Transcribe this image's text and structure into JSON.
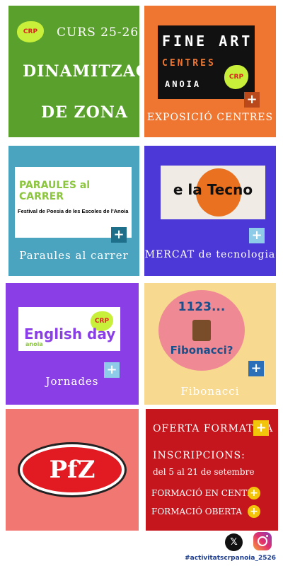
{
  "tiles": {
    "zona": {
      "logo": "CRP",
      "course": "CURS 25-26",
      "title_line1": "DINAMITZACIÓ",
      "title_line2": "DE ZONA",
      "color": "#5aa02c"
    },
    "fineart": {
      "image_line1": "FINE ART",
      "image_line2": "CENTRES",
      "image_line3": "ANOIA",
      "logo": "CRP",
      "label": "EXPOSICIÓ CENTRES",
      "color": "#ee7630"
    },
    "paraules": {
      "image_title": "PARAULES al CARRER",
      "image_subtitle": "Festival de Poesia de les Escoles de l'Anoia",
      "label": "Paraules al carrer",
      "color": "#4aa3bf"
    },
    "mercat": {
      "image_text": "e la Tecno",
      "label": "MERCAT de tecnologia",
      "color": "#4b38d6"
    },
    "jornades": {
      "image_title": "English day",
      "image_subtitle": "anoia",
      "logo": "CRP",
      "label": "Jornades",
      "color": "#8a3fe6"
    },
    "fibonacci": {
      "image_top": "1123...",
      "image_bottom": "Fibonacci?",
      "label": "Fibonacci",
      "color": "#f8d990"
    },
    "pfz": {
      "logo_text": "PfZ",
      "color": "#f17772"
    },
    "oferta": {
      "title": "OFERTA FORMATIVA",
      "inscripcions": "INSCRIPCIONS:",
      "dates": "del 5 al 21 de setembre",
      "link1": "FORMACIÓ EN CENTRE",
      "link2": "FORMACIÓ OBERTA",
      "color": "#c5161d"
    }
  },
  "footer": {
    "hashtag": "#activitatscrpanoia_2526",
    "x_icon": "x-icon",
    "instagram_icon": "instagram-icon"
  }
}
